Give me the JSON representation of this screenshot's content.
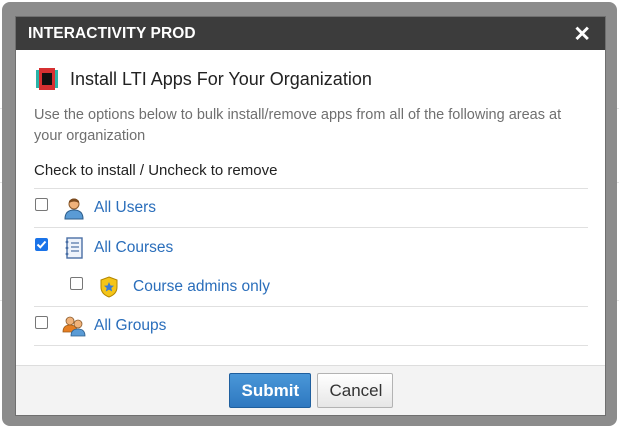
{
  "dialog": {
    "title": "INTERACTIVITY PROD",
    "close_icon": "close-icon",
    "heading": "Install LTI Apps For Your Organization",
    "description": "Use the options below to bulk install/remove apps from all of the following areas at your organization",
    "instruction": "Check to install / Uncheck to remove"
  },
  "options": [
    {
      "label": "All Users",
      "checked": false,
      "icon": "user-icon"
    },
    {
      "label": "All Courses",
      "checked": true,
      "icon": "notebook-icon"
    },
    {
      "label": "Course admins only",
      "checked": false,
      "icon": "admin-shield-icon"
    },
    {
      "label": "All Groups",
      "checked": false,
      "icon": "group-icon"
    }
  ],
  "footer": {
    "submit_label": "Submit",
    "cancel_label": "Cancel"
  },
  "colors": {
    "titlebar": "#3c3c3c",
    "link": "#2a6ebb",
    "submit": "#2e78c0"
  }
}
